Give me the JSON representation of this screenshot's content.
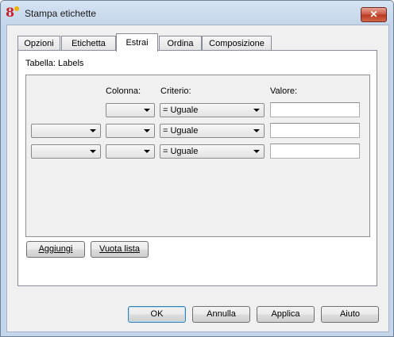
{
  "window": {
    "title": "Stampa etichette",
    "app_icon_glyph": "8",
    "close_glyph": "✕"
  },
  "tabs": [
    {
      "label": "Opzioni",
      "active": false
    },
    {
      "label": "Etichetta",
      "active": false
    },
    {
      "label": "Estrai",
      "active": true
    },
    {
      "label": "Ordina",
      "active": false
    },
    {
      "label": "Composizione",
      "active": false
    }
  ],
  "extract": {
    "table_label": "Tabella: Labels",
    "headers": {
      "colonna": "Colonna:",
      "criterio": "Criterio:",
      "valore": "Valore:"
    },
    "rows": [
      {
        "operator": "",
        "column": "",
        "criterion": "= Uguale",
        "value": ""
      },
      {
        "operator": "",
        "column": "",
        "criterion": "= Uguale",
        "value": ""
      },
      {
        "operator": "",
        "column": "",
        "criterion": "= Uguale",
        "value": ""
      }
    ],
    "add_button": "Aggiungi",
    "clear_button": "Vuota lista"
  },
  "footer": {
    "ok": "OK",
    "cancel": "Annulla",
    "apply": "Applica",
    "help": "Aiuto"
  }
}
